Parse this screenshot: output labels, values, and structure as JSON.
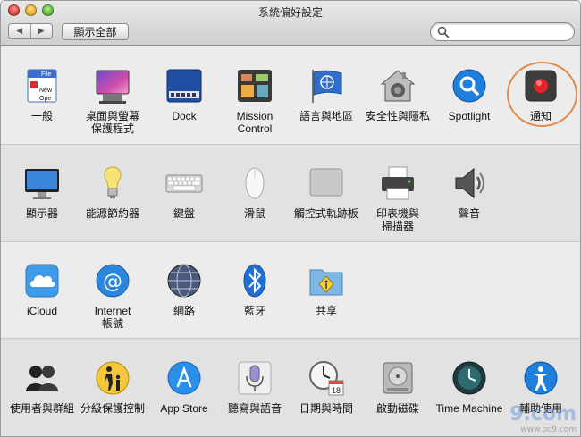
{
  "window": {
    "title": "系統偏好設定"
  },
  "toolbar": {
    "back": "◀",
    "forward": "▶",
    "show_all": "顯示全部",
    "search_placeholder": ""
  },
  "rows": [
    [
      {
        "id": "general",
        "label": "一般",
        "icon": "general-icon"
      },
      {
        "id": "desktop",
        "label": "桌面與螢幕\n保護程式",
        "icon": "desktop-icon"
      },
      {
        "id": "dock",
        "label": "Dock",
        "icon": "dock-icon"
      },
      {
        "id": "mission",
        "label": "Mission\nControl",
        "icon": "mission-control-icon"
      },
      {
        "id": "language",
        "label": "語言與地區",
        "icon": "language-flag-icon"
      },
      {
        "id": "security",
        "label": "安全性與隱私",
        "icon": "security-house-icon"
      },
      {
        "id": "spotlight",
        "label": "Spotlight",
        "icon": "spotlight-icon"
      },
      {
        "id": "notifications",
        "label": "通知",
        "icon": "notifications-icon"
      }
    ],
    [
      {
        "id": "displays",
        "label": "顯示器",
        "icon": "display-icon"
      },
      {
        "id": "energy",
        "label": "能源節約器",
        "icon": "lightbulb-icon"
      },
      {
        "id": "keyboard",
        "label": "鍵盤",
        "icon": "keyboard-icon"
      },
      {
        "id": "mouse",
        "label": "滑鼠",
        "icon": "mouse-icon"
      },
      {
        "id": "trackpad",
        "label": "觸控式軌跡板",
        "icon": "trackpad-icon"
      },
      {
        "id": "printers",
        "label": "印表機與\n掃描器",
        "icon": "printer-icon"
      },
      {
        "id": "sound",
        "label": "聲音",
        "icon": "speaker-icon"
      }
    ],
    [
      {
        "id": "icloud",
        "label": "iCloud",
        "icon": "icloud-icon"
      },
      {
        "id": "internet",
        "label": "Internet\n帳號",
        "icon": "internet-accounts-icon"
      },
      {
        "id": "network",
        "label": "網路",
        "icon": "network-globe-icon"
      },
      {
        "id": "bluetooth",
        "label": "藍牙",
        "icon": "bluetooth-icon"
      },
      {
        "id": "sharing",
        "label": "共享",
        "icon": "sharing-folder-icon"
      }
    ],
    [
      {
        "id": "users",
        "label": "使用者與群組",
        "icon": "users-icon"
      },
      {
        "id": "parental",
        "label": "分級保護控制",
        "icon": "parental-controls-icon"
      },
      {
        "id": "appstore",
        "label": "App Store",
        "icon": "app-store-icon"
      },
      {
        "id": "dictation",
        "label": "聽寫與語音",
        "icon": "microphone-icon"
      },
      {
        "id": "datetime",
        "label": "日期與時間",
        "icon": "clock-calendar-icon"
      },
      {
        "id": "startup",
        "label": "啟動磁碟",
        "icon": "startup-disk-icon"
      },
      {
        "id": "timemachine",
        "label": "Time Machine",
        "icon": "time-machine-icon"
      },
      {
        "id": "accessibility",
        "label": "輔助使用",
        "icon": "accessibility-icon"
      }
    ]
  ],
  "watermark": {
    "text": "9.com",
    "sub": "www.pc9.com"
  }
}
